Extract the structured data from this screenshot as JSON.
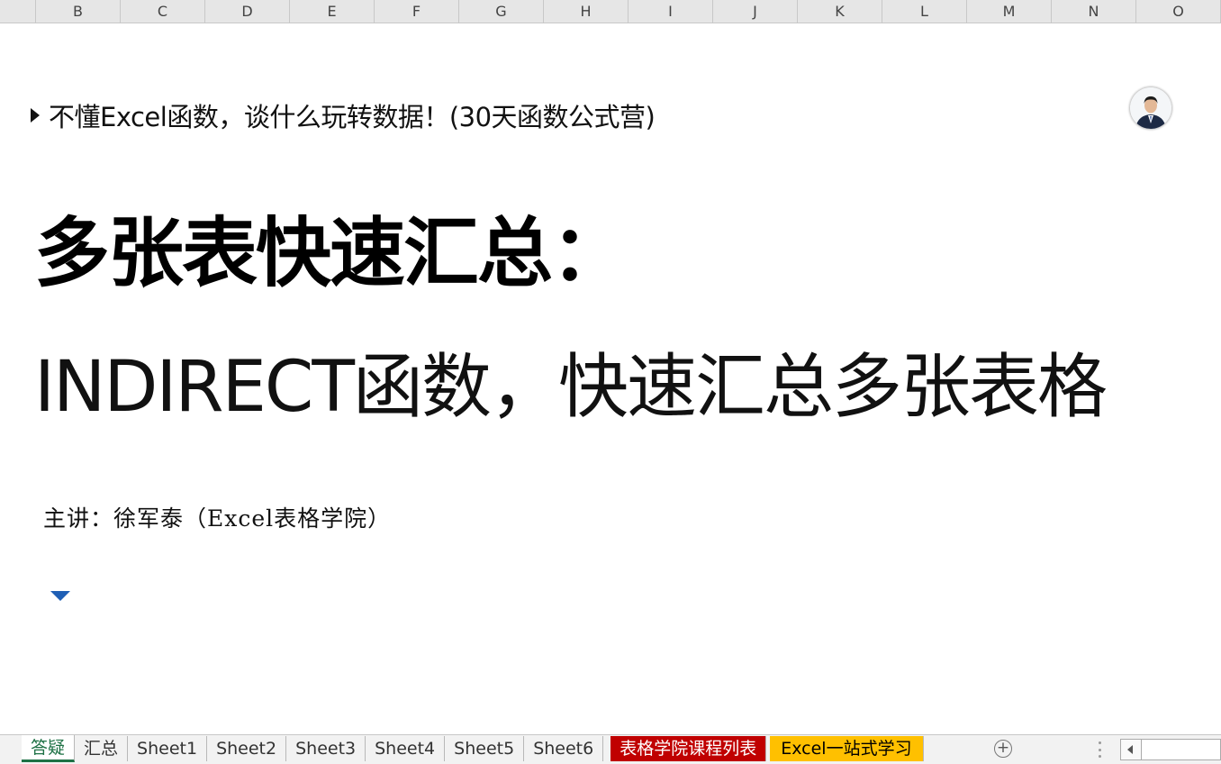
{
  "columns": [
    "B",
    "C",
    "D",
    "E",
    "F",
    "G",
    "H",
    "I",
    "J",
    "K",
    "L",
    "M",
    "N",
    "O"
  ],
  "sheet": {
    "subtitle": "不懂Excel函数，谈什么玩转数据！(30天函数公式营)",
    "title": "多张表快速汇总：",
    "headline": "INDIRECT函数，快速汇总多张表格",
    "presenter": "主讲：徐军泰（Excel表格学院）"
  },
  "tabs": [
    {
      "label": "答疑",
      "style": "active"
    },
    {
      "label": "汇总",
      "style": "normal"
    },
    {
      "label": "Sheet1",
      "style": "normal"
    },
    {
      "label": "Sheet2",
      "style": "normal"
    },
    {
      "label": "Sheet3",
      "style": "normal"
    },
    {
      "label": "Sheet4",
      "style": "normal"
    },
    {
      "label": "Sheet5",
      "style": "normal"
    },
    {
      "label": "Sheet6",
      "style": "normal"
    },
    {
      "label": "表格学院课程列表",
      "style": "red"
    },
    {
      "label": "Excel一站式学习",
      "style": "yellow"
    }
  ],
  "add_sheet_symbol": "+",
  "colors": {
    "active_tab": "#1e7145",
    "red_tab": "#c00000",
    "yellow_tab": "#ffc000",
    "dropdown_arrow": "#1f5fb5"
  },
  "icons": {
    "subtitle_bullet": "play-triangle-icon",
    "avatar": "presenter-avatar",
    "dropdown": "dropdown-arrow-icon",
    "add_sheet": "plus-circle-icon",
    "scroll_left": "scroll-left-icon"
  }
}
